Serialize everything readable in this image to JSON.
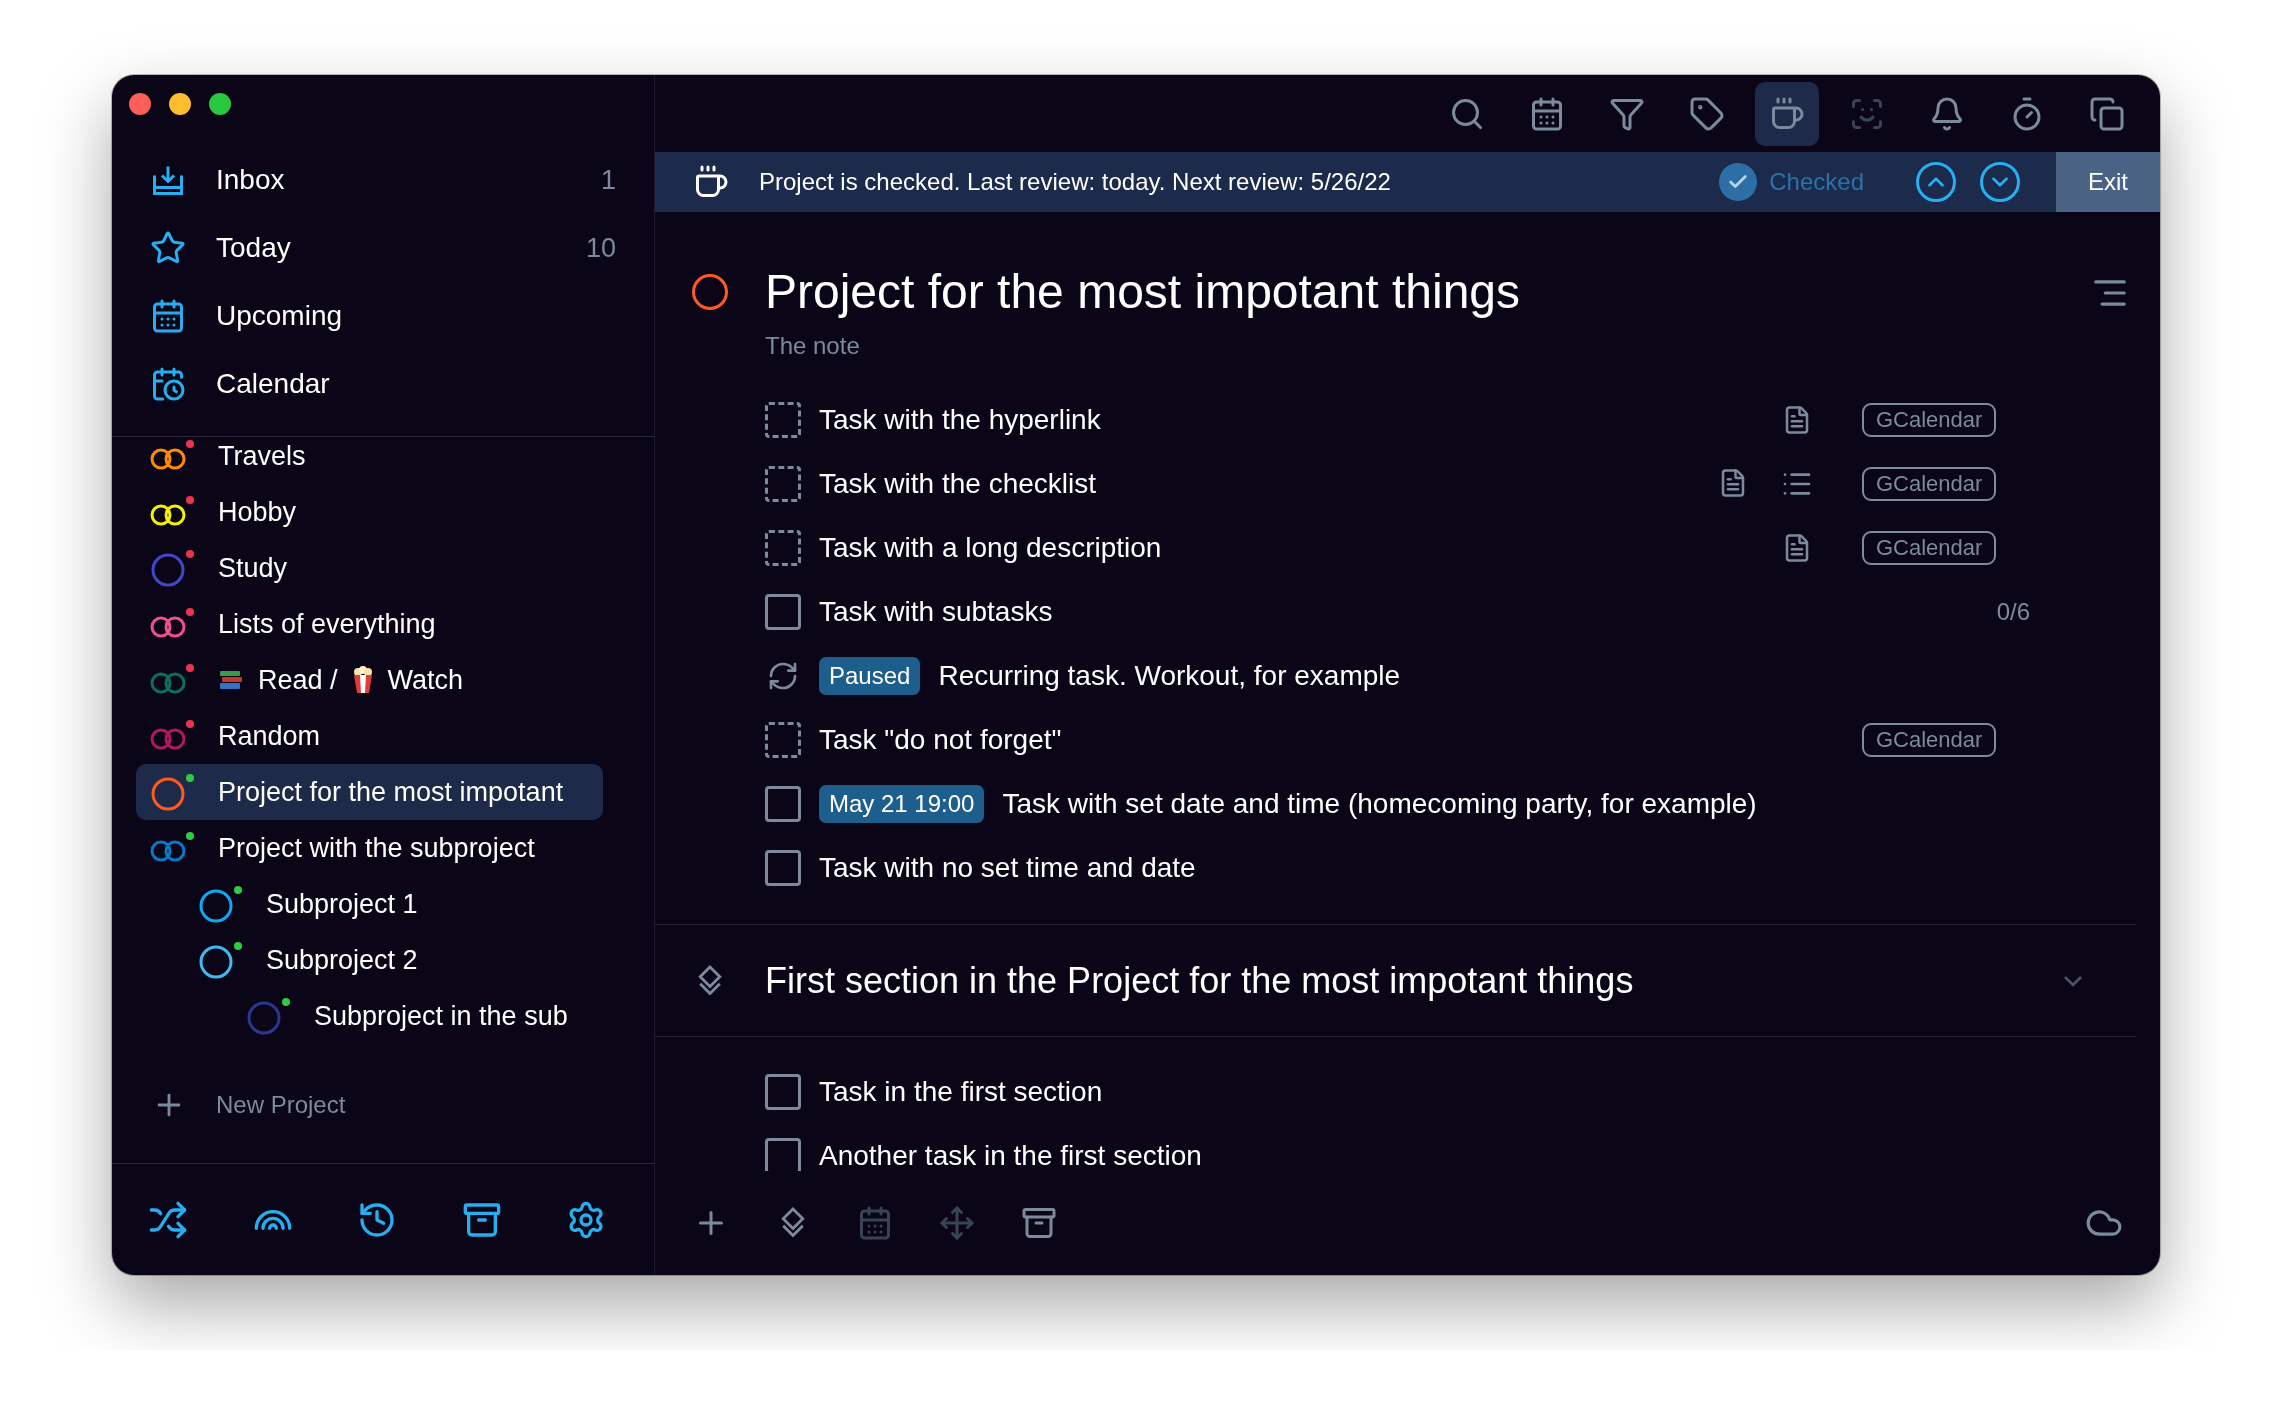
{
  "sidebar": {
    "nav": [
      {
        "kind": "inbox",
        "label": "Inbox",
        "count": "1",
        "selected": false
      },
      {
        "kind": "today",
        "label": "Today",
        "count": "10",
        "selected": false
      },
      {
        "kind": "upcoming",
        "label": "Upcoming",
        "selected": false
      },
      {
        "kind": "calendar",
        "label": "Calendar",
        "selected": false
      }
    ],
    "projects": [
      {
        "kind": "rings",
        "color": "#ff8c00",
        "dot": {
          "color": "#e8344e"
        },
        "segments": [
          {
            "kind": "text",
            "text": "Travels"
          }
        ],
        "selected": false
      },
      {
        "kind": "rings",
        "color": "#f5f000",
        "dot": {
          "color": "#e8344e"
        },
        "segments": [
          {
            "kind": "text",
            "text": "Hobby"
          }
        ],
        "selected": false
      },
      {
        "kind": "circle",
        "color": "#4048c8",
        "dot": {
          "color": "#e8344e"
        },
        "segments": [
          {
            "kind": "text",
            "text": "Study"
          }
        ],
        "selected": false
      },
      {
        "kind": "rings",
        "color": "#f0508a",
        "dot": {
          "color": "#e8344e"
        },
        "segments": [
          {
            "kind": "text",
            "text": "Lists of everything"
          }
        ],
        "selected": false
      },
      {
        "kind": "rings",
        "color": "#0c6e5c",
        "dot": {
          "color": "#e8344e"
        },
        "segments": [
          {
            "kind": "books"
          },
          {
            "kind": "text",
            "text": "Read /"
          },
          {
            "kind": "popcorn"
          },
          {
            "kind": "text",
            "text": "Watch"
          }
        ],
        "selected": false
      },
      {
        "kind": "rings",
        "color": "#b0195e",
        "dot": {
          "color": "#e8344e"
        },
        "segments": [
          {
            "kind": "text",
            "text": "Random"
          }
        ],
        "selected": false
      },
      {
        "kind": "circle",
        "color": "#ff5a1f",
        "dot": {
          "color": "#2ecc40"
        },
        "segments": [
          {
            "kind": "text",
            "text": "Project for the most impotant"
          }
        ],
        "selected": true
      },
      {
        "kind": "rings",
        "color": "#0a78c8",
        "dot": {
          "color": "#2ecc40"
        },
        "segments": [
          {
            "kind": "text",
            "text": "Project with the subproject"
          }
        ],
        "selected": false,
        "children": [
          {
            "kind": "circle",
            "color": "#10a8f0",
            "dot": {
              "color": "#2ecc40"
            },
            "segments": [
              {
                "kind": "text",
                "text": "Subproject 1"
              }
            ],
            "selected": false
          },
          {
            "kind": "circle",
            "color": "#40b8f0",
            "dot": {
              "color": "#2ecc40"
            },
            "segments": [
              {
                "kind": "text",
                "text": "Subproject 2"
              }
            ],
            "selected": false,
            "children": [
              {
                "kind": "circle",
                "color": "#283890",
                "dot": {
                  "color": "#2ecc40"
                },
                "segments": [
                  {
                    "kind": "text",
                    "text": "Subproject in the sub"
                  }
                ],
                "selected": false
              }
            ]
          }
        ]
      }
    ],
    "new_project": "New Project",
    "footer": [
      {
        "kind": "shuffle"
      },
      {
        "kind": "rainbow"
      },
      {
        "kind": "history"
      },
      {
        "kind": "archive"
      },
      {
        "kind": "settings"
      }
    ]
  },
  "toolbar": [
    {
      "kind": "search",
      "selected": false,
      "disabled": false
    },
    {
      "kind": "calendar",
      "selected": false,
      "disabled": false
    },
    {
      "kind": "filter",
      "selected": false,
      "disabled": false
    },
    {
      "kind": "tag",
      "selected": false,
      "disabled": false
    },
    {
      "kind": "review",
      "selected": true,
      "disabled": false
    },
    {
      "kind": "focus",
      "selected": false,
      "disabled": true
    },
    {
      "kind": "bell",
      "selected": false,
      "disabled": false
    },
    {
      "kind": "timer",
      "selected": false,
      "disabled": false
    },
    {
      "kind": "copy",
      "selected": false,
      "disabled": false
    }
  ],
  "review_banner": {
    "message": "Project is checked. Last review: today. Next review: 5/26/22",
    "checked": true,
    "checked_label": "Checked",
    "exit": "Exit"
  },
  "project": {
    "title": "Project for the most impotant things",
    "note": "The note",
    "tasks": [
      {
        "kind": "event",
        "title": "Task with the hyperlink",
        "checked": false,
        "has_note": true,
        "has_checklist": false,
        "tag": "GCalendar"
      },
      {
        "kind": "event",
        "title": "Task with the checklist",
        "checked": false,
        "has_note": true,
        "has_checklist": true,
        "tag": "GCalendar"
      },
      {
        "kind": "event",
        "title": "Task with a long description",
        "checked": false,
        "has_note": true,
        "has_checklist": false,
        "tag": "GCalendar"
      },
      {
        "kind": "task",
        "title": "Task with subtasks",
        "checked": false,
        "has_note": false,
        "has_checklist": false,
        "count": "0/6"
      },
      {
        "kind": "recurring",
        "badge": "Paused",
        "title": "Recurring task. Workout, for example",
        "has_note": false,
        "has_checklist": false
      },
      {
        "kind": "event",
        "title": "Task \"do not forget\"",
        "checked": false,
        "has_note": false,
        "has_checklist": false,
        "tag": "GCalendar"
      },
      {
        "kind": "task",
        "badge": "May 21 19:00",
        "title": "Task with set date and time (homecoming party, for example)",
        "checked": false,
        "has_note": false,
        "has_checklist": false
      },
      {
        "kind": "task",
        "title": "Task with no set time and date",
        "checked": false,
        "has_note": false,
        "has_checklist": false
      }
    ],
    "sections": [
      {
        "title": "First section in the Project for the most impotant things",
        "expanded": true,
        "tasks": [
          {
            "kind": "task",
            "title": "Task in the first section",
            "checked": false,
            "has_note": false,
            "has_checklist": false
          },
          {
            "kind": "task",
            "title": "Another task in the first section",
            "checked": false,
            "has_note": false,
            "has_checklist": false
          }
        ]
      }
    ]
  },
  "bottom_bar": [
    {
      "kind": "add",
      "disabled": false
    },
    {
      "kind": "section",
      "disabled": false
    },
    {
      "kind": "calendar",
      "disabled": true
    },
    {
      "kind": "move",
      "disabled": true
    },
    {
      "kind": "archive",
      "disabled": false
    }
  ]
}
